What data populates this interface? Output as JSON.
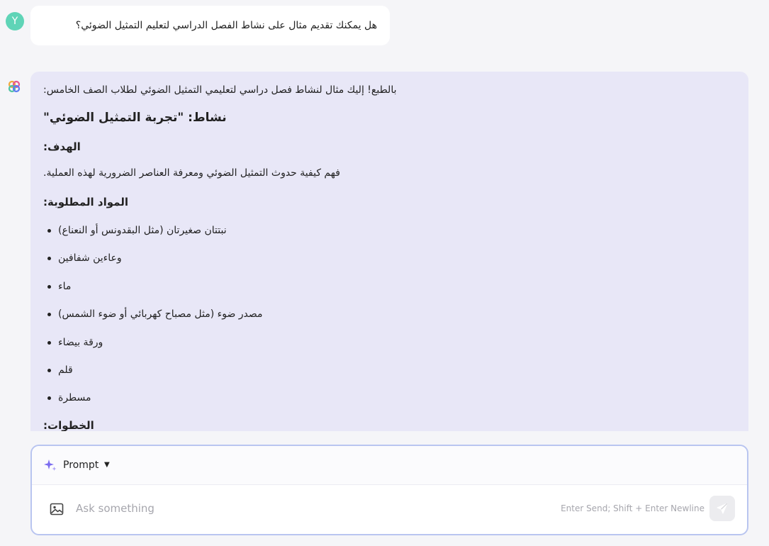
{
  "user": {
    "avatar_letter": "Y",
    "message": "هل يمكنك تقديم مثال على نشاط الفصل الدراسي لتعليم التمثيل الضوئي؟"
  },
  "assistant": {
    "intro": "بالطبع! إليك مثال لنشاط فصل دراسي لتعليمي التمثيل الضوئي لطلاب الصف الخامس:",
    "activity_title": "نشاط: \"تجربة التمثيل الضوئي\"",
    "goal_heading": "الهدف:",
    "goal_text": "فهم كيفية حدوث التمثيل الضوئي ومعرفة العناصر الضرورية لهذه العملية.",
    "materials_heading": "المواد المطلوبة:",
    "materials": [
      "نبتتان صغيرتان (مثل البقدونس أو النعناع)",
      "وعاءين شفافين",
      "ماء",
      "مصدر ضوء (مثل مصباح كهربائي أو ضوء الشمس)",
      "ورقة بيضاء",
      "قلم",
      "مسطرة"
    ],
    "steps_heading": "الخطوات:"
  },
  "composer": {
    "mode_label": "Prompt",
    "placeholder": "Ask something",
    "hint": "Enter Send; Shift + Enter Newline"
  },
  "colors": {
    "user_avatar": "#5fd4b7",
    "assistant_card": "#e8e7f7",
    "input_border": "#b9c5f0",
    "sparkle": "#7b6cf0"
  }
}
